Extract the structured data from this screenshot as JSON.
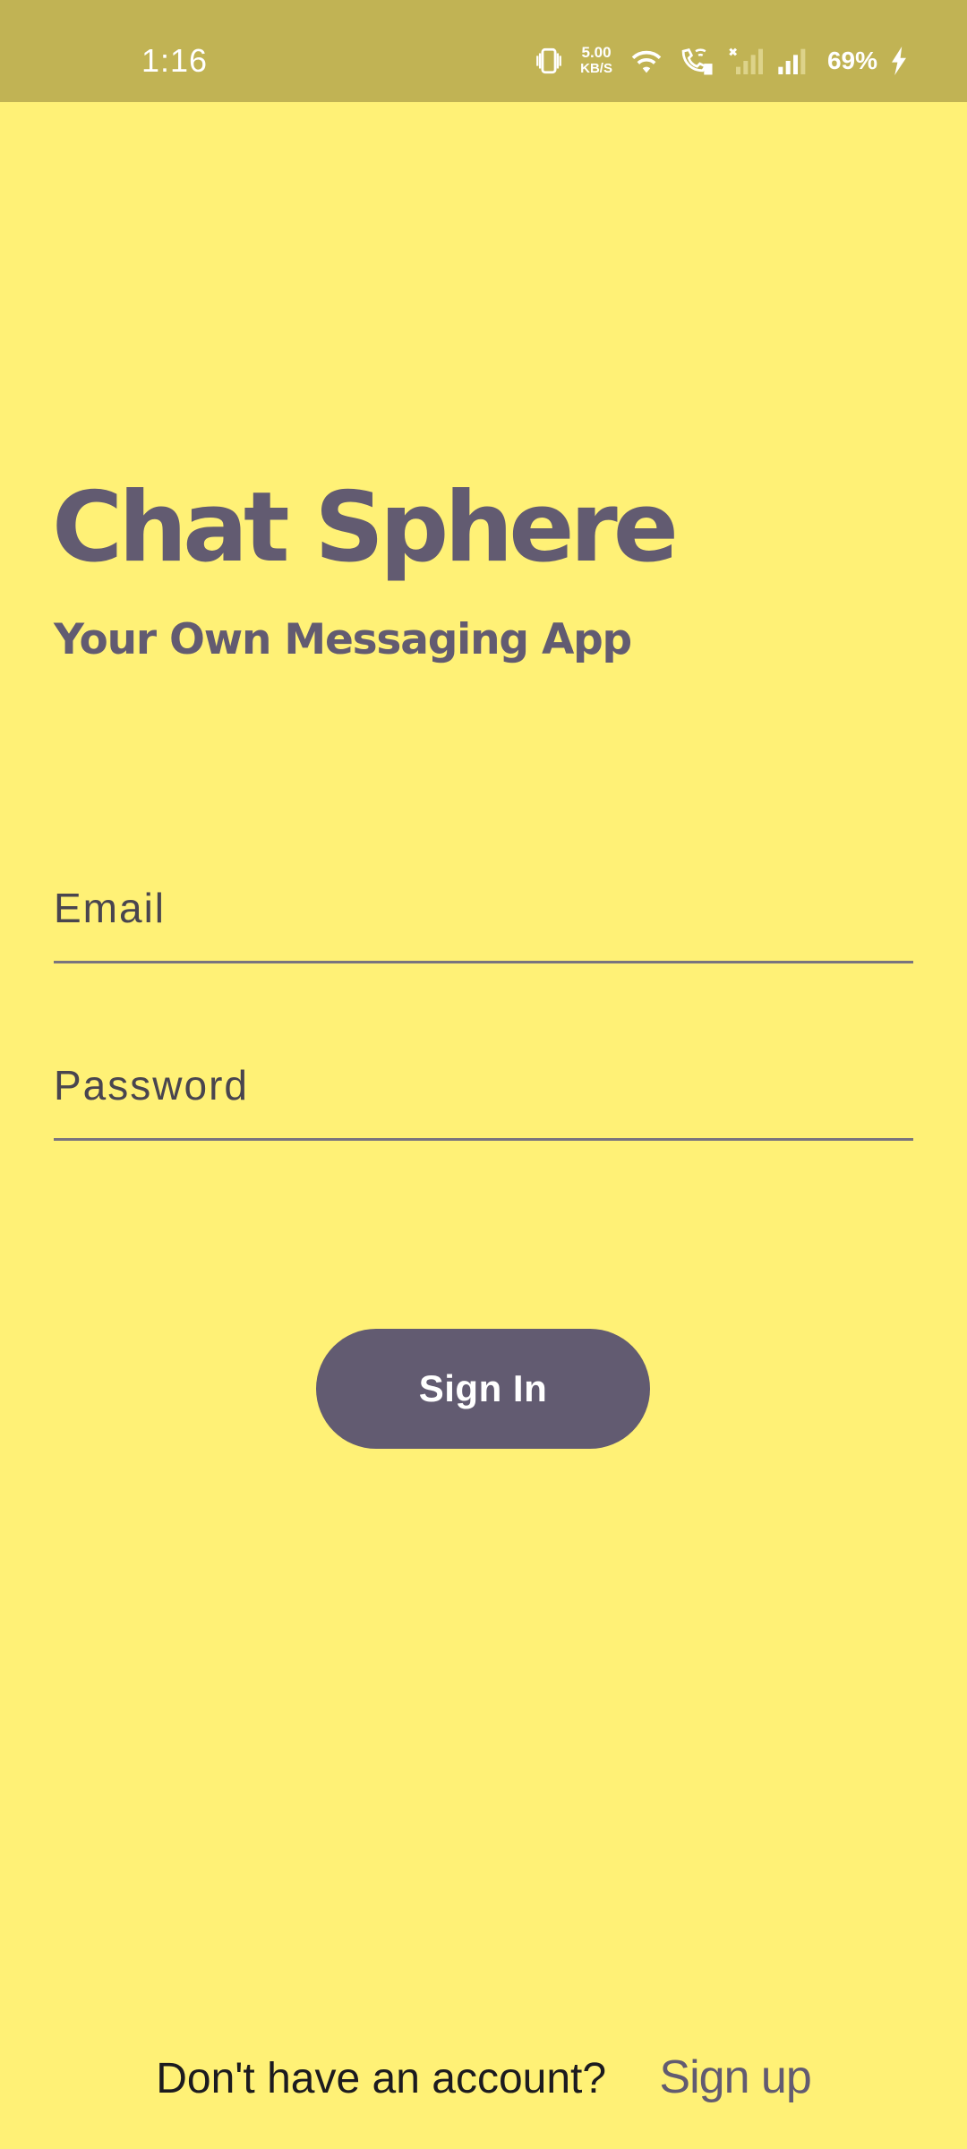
{
  "status_bar": {
    "time": "1:16",
    "net_speed_value": "5.00",
    "net_speed_unit": "KB/S",
    "battery_percent": "69%",
    "icons": [
      "vibrate-icon",
      "wifi-icon",
      "wifi-calling-icon",
      "no-signal-icon",
      "signal-icon",
      "charging-icon"
    ],
    "background_color": "#C1B354"
  },
  "app": {
    "title": "Chat Sphere",
    "subtitle": "Your Own Messaging App"
  },
  "form": {
    "email_placeholder": "Email",
    "password_placeholder": "Password",
    "sign_in_label": "Sign In"
  },
  "footer": {
    "prompt": "Don't have an account?",
    "sign_up_label": "Sign up"
  },
  "colors": {
    "background": "#FFF176",
    "primary": "#625B71",
    "field_underline": "#79747E"
  }
}
